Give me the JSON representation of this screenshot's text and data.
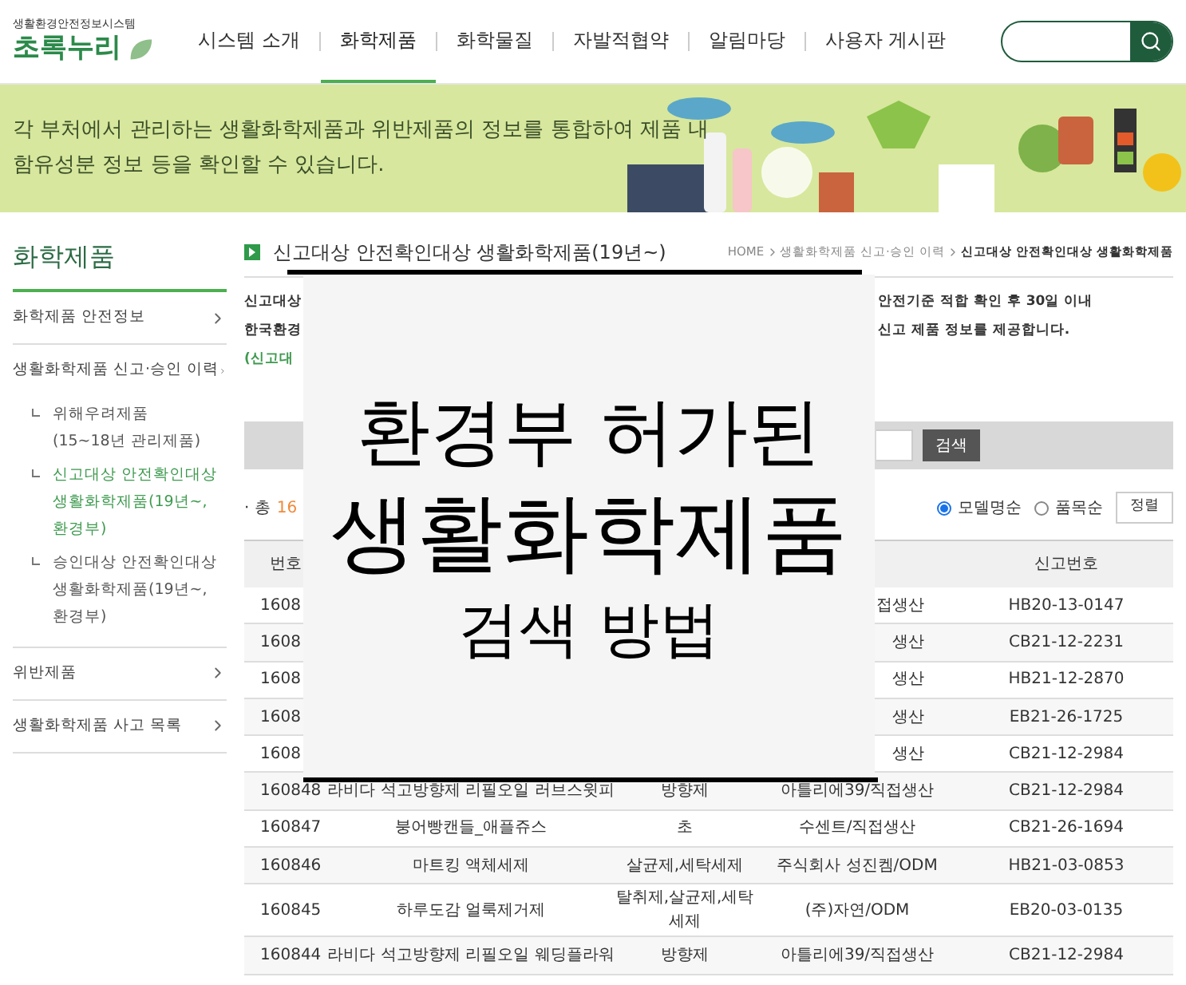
{
  "logo": {
    "subtitle": "생활환경안전정보시스템",
    "name": "초록누리"
  },
  "nav": [
    {
      "label": "시스템 소개",
      "selected": false
    },
    {
      "label": "화학제품",
      "selected": true
    },
    {
      "label": "화학물질",
      "selected": false
    },
    {
      "label": "자발적협약",
      "selected": false
    },
    {
      "label": "알림마당",
      "selected": false
    },
    {
      "label": "사용자 게시판",
      "selected": false
    }
  ],
  "banner": {
    "text": "각 부처에서 관리하는 생활화학제품과 위반제품의 정보를 통합하여 제품 내\n함유성분 정보 등을 확인할 수 있습니다."
  },
  "sidebar": {
    "title": "화학제품",
    "items": [
      {
        "label": "화학제품 안전정보"
      },
      {
        "label": "생활화학제품 신고·승인 이력",
        "children": [
          {
            "label": "위해우려제품\n(15~18년 관리제품)",
            "selected": false
          },
          {
            "label": "신고대상 안전확인대상\n생활화학제품(19년~,\n환경부)",
            "selected": true
          },
          {
            "label": "승인대상 안전확인대상\n생활화학제품(19년~,\n환경부)",
            "selected": false
          }
        ]
      },
      {
        "label": "위반제품"
      },
      {
        "label": "생활화학제품 사고 목록"
      }
    ]
  },
  "page": {
    "title": "신고대상 안전확인대상 생활화학제품(19년~)",
    "breadcrumb": [
      "HOME",
      "생활화학제품 신고·승인 이력",
      "신고대상 안전확인대상 생활화학제품"
    ]
  },
  "intro": {
    "lines": [
      {
        "left": "신고대상",
        "right": "안전기준 적합 확인 후 30일 이내"
      },
      {
        "left": "한국환경",
        "right": "신고 제품 정보를 제공합니다."
      }
    ],
    "link": "(신고대"
  },
  "search_form": {
    "button": "검색"
  },
  "count": {
    "label": "· 총",
    "value": "16"
  },
  "sort": {
    "options": [
      {
        "label": "모델명순",
        "selected": true
      },
      {
        "label": "품목순",
        "selected": false
      }
    ],
    "button": "정렬"
  },
  "table": {
    "columns": [
      {
        "label": "번호"
      },
      {},
      {},
      {},
      {
        "label": "신고번호"
      }
    ],
    "rows": [
      {
        "number": "1608",
        "company": "접생산",
        "code": "HB20-13-0147"
      },
      {
        "number": "1608",
        "company": "생산",
        "code": "CB21-12-2231"
      },
      {
        "number": "1608",
        "company": "생산",
        "code": "HB21-12-2870"
      },
      {
        "number": "1608",
        "company": "생산",
        "code": "EB21-26-1725"
      },
      {
        "number": "1608",
        "company": "생산",
        "code": "CB21-12-2984"
      },
      {
        "number": "160848",
        "product": "라비다 석고방향제 리필오일 러브스윗피",
        "item": "방향제",
        "company": "아틀리에39/직접생산",
        "code": "CB21-12-2984"
      },
      {
        "number": "160847",
        "product": "붕어빵캔들_애플쥬스",
        "item": "초",
        "company": "수센트/직접생산",
        "code": "CB21-26-1694"
      },
      {
        "number": "160846",
        "product": "마트킹 액체세제",
        "item": "살균제,세탁세제",
        "company": "주식회사 성진켐/ODM",
        "code": "HB21-03-0853"
      },
      {
        "number": "160845",
        "product": "하루도감 얼룩제거제",
        "item": "탈취제,살균제,세탁\n세제",
        "company": "(주)자연/ODM",
        "code": "EB20-03-0135"
      },
      {
        "number": "160844",
        "product": "라비다 석고방향제 리필오일 웨딩플라워",
        "item": "방향제",
        "company": "아틀리에39/직접생산",
        "code": "CB21-12-2984"
      }
    ]
  },
  "overlay": {
    "lines": [
      "환경부 허가된",
      "생활화학제품",
      "검색 방법"
    ]
  }
}
